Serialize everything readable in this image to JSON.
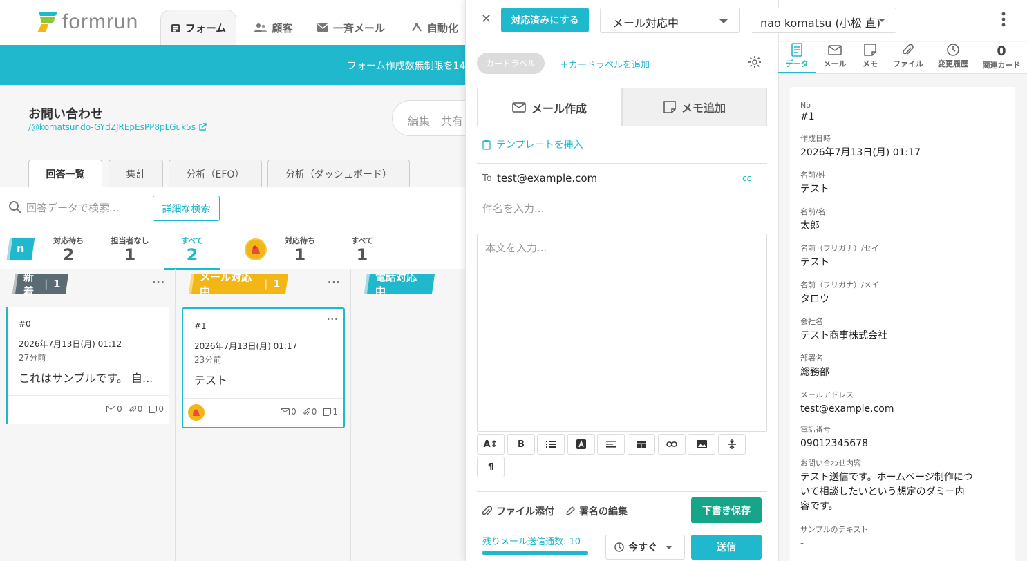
{
  "header": {
    "brand": "formrun",
    "tabs": [
      {
        "label": "フォーム"
      },
      {
        "label": "顧客"
      },
      {
        "label": "一斉メール"
      },
      {
        "label": "自動化"
      }
    ],
    "banner": "フォーム作成数無制限を14"
  },
  "form": {
    "title": "お問い合わせ",
    "url": "/@komatsundo-GYdZJREpEsPP8pLGuk5s",
    "edit_label": "編集　共有"
  },
  "subtabs": [
    "回答一覧",
    "集計",
    "分析（EFO）",
    "分析（ダッシュボード）"
  ],
  "search": {
    "placeholder": "回答データで検索...",
    "advanced": "詳細な検索"
  },
  "stats": [
    {
      "label": "対応待ち",
      "count": "2"
    },
    {
      "label": "担当者なし",
      "count": "1"
    },
    {
      "label": "すべて",
      "count": "2"
    },
    {
      "label": "対応待ち",
      "count": "1"
    },
    {
      "label": "すべて",
      "count": "1"
    }
  ],
  "team_badge": "n",
  "columns": [
    {
      "title": "新着",
      "count": "1",
      "color": "#5b6b73"
    },
    {
      "title": "メール対応中",
      "count": "1",
      "color": "#f2b616"
    },
    {
      "title": "電話対応中",
      "count": "",
      "color": "#1fb8cc"
    }
  ],
  "cards": [
    {
      "no": "#0",
      "date": "2026年7月13日(月) 01:12",
      "ago": "27分前",
      "body": "これはサンプルです。 自...",
      "mail": "0",
      "file": "0",
      "memo": "0"
    },
    {
      "no": "#1",
      "date": "2026年7月13日(月) 01:17",
      "ago": "23分前",
      "body": "テスト",
      "mail": "0",
      "file": "0",
      "memo": "1"
    }
  ],
  "panel": {
    "done_button": "対応済みにする",
    "status_select": "メール対応中",
    "assignee_select": "nao komatsu (小松 直)",
    "card_label_chip": "カードラベル",
    "add_label": "＋カードラベルを追加",
    "tab_mail": "メール作成",
    "tab_memo": "メモ追加",
    "template": "テンプレートを挿入",
    "to_label": "To",
    "to_value": "test@example.com",
    "cc": "cc",
    "subject_placeholder": "件名を入力...",
    "body_placeholder": "本文を入力...",
    "attach": "ファイル添付",
    "signature": "署名の編集",
    "draft": "下書き保存",
    "remaining": "残りメール送信通数: 10",
    "schedule": "今すぐ",
    "send": "送信"
  },
  "right_tabs": [
    {
      "label": "データ"
    },
    {
      "label": "メール"
    },
    {
      "label": "メモ"
    },
    {
      "label": "ファイル"
    },
    {
      "label": "変更履歴"
    },
    {
      "label": "関連カード",
      "count": "0"
    }
  ],
  "fields": [
    {
      "key": "No",
      "value": "#1"
    },
    {
      "key": "作成日時",
      "value": "2026年7月13日(月) 01:17"
    },
    {
      "key": "名前/姓",
      "value": "テスト"
    },
    {
      "key": "名前/名",
      "value": "太郎"
    },
    {
      "key": "名前（フリガナ）/セイ",
      "value": "テスト"
    },
    {
      "key": "名前（フリガナ）/メイ",
      "value": "タロウ"
    },
    {
      "key": "会社名",
      "value": "テスト商事株式会社"
    },
    {
      "key": "部署名",
      "value": "総務部"
    },
    {
      "key": "メールアドレス",
      "value": "test@example.com"
    },
    {
      "key": "電話番号",
      "value": "09012345678"
    },
    {
      "key": "お問い合わせ内容",
      "value": "テスト送信です。ホームページ制作について相談したいという想定のダミー内容です。"
    },
    {
      "key": "サンプルのテキスト",
      "value": "-"
    }
  ],
  "colors": {
    "accent": "#1fb8cc",
    "draft": "#17a589",
    "mail_column": "#f2b616",
    "new_column": "#5b6b73"
  }
}
